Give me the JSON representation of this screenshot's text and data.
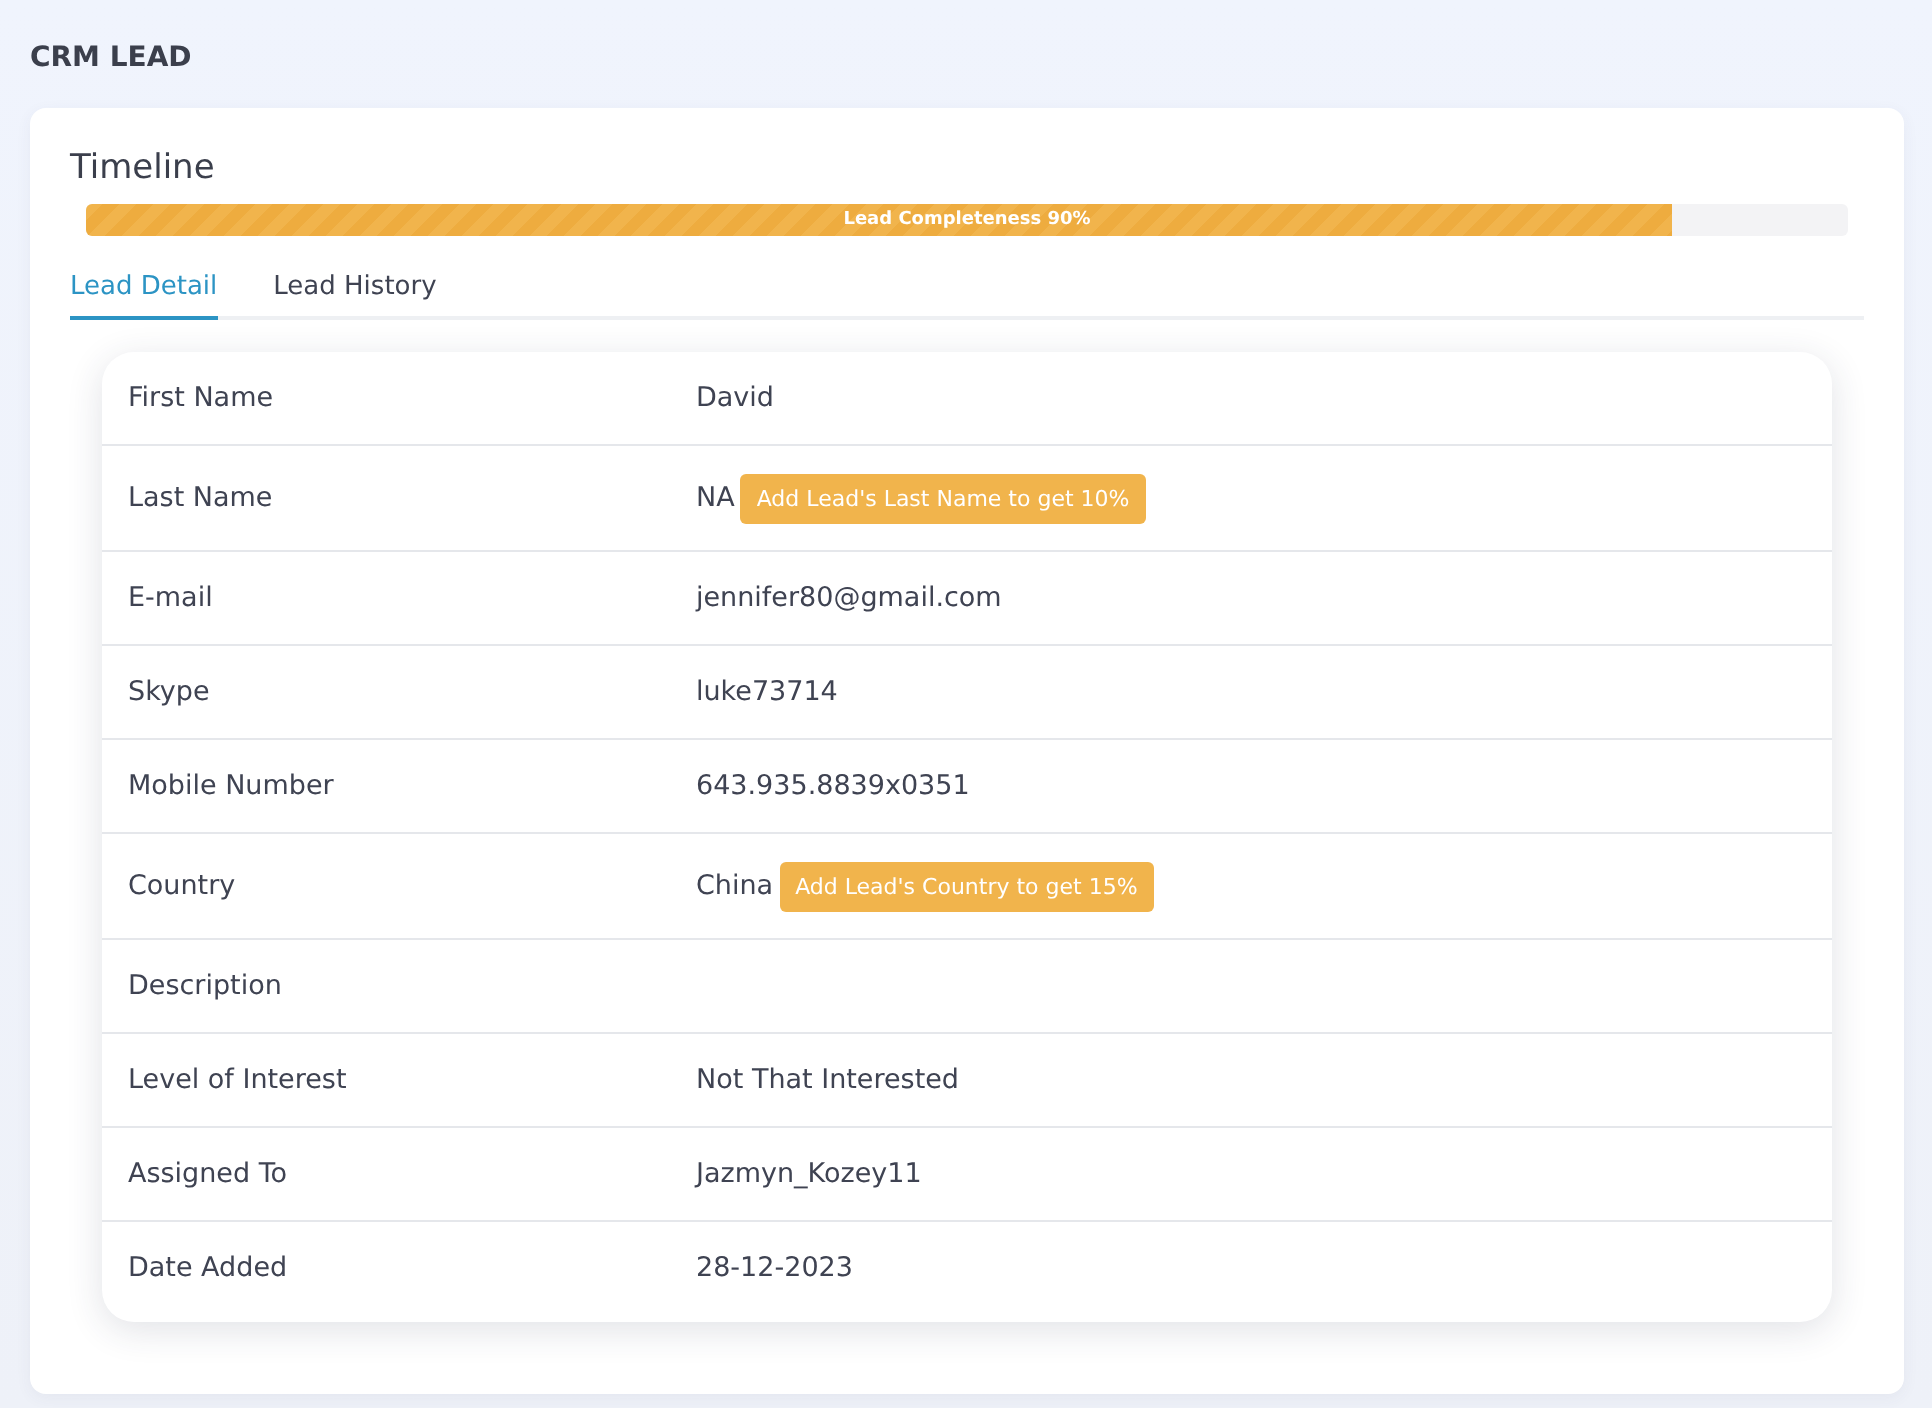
{
  "page_title": "CRM LEAD",
  "timeline": {
    "title": "Timeline",
    "progress": {
      "label": "Lead Completeness 90%",
      "level": 0.9
    }
  },
  "tabs": [
    {
      "label": "Lead Detail",
      "selected": true
    },
    {
      "label": "Lead History",
      "selected": false
    }
  ],
  "fields": [
    {
      "label": "First Name",
      "value": "David"
    },
    {
      "label": "Last Name",
      "value": "NA",
      "hint": "Add Lead's Last Name to get 10%"
    },
    {
      "label": "E-mail",
      "value": "jennifer80@gmail.com"
    },
    {
      "label": "Skype",
      "value": "luke73714"
    },
    {
      "label": "Mobile Number",
      "value": "643.935.8839x0351"
    },
    {
      "label": "Country",
      "value": "China",
      "hint": "Add Lead's Country to get 15%"
    },
    {
      "label": "Description"
    },
    {
      "label": "Level of Interest",
      "value": "Not That Interested"
    },
    {
      "label": "Assigned To",
      "value": "Jazmyn_Kozey11"
    },
    {
      "label": "Date Added",
      "value": "28-12-2023"
    }
  ]
}
